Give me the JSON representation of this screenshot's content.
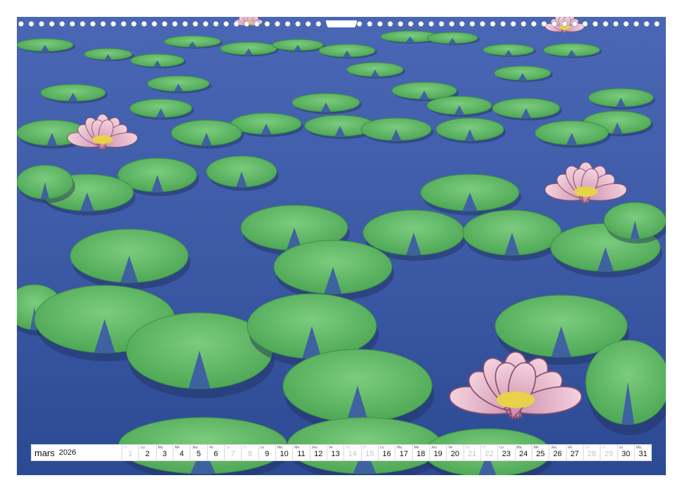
{
  "calendar": {
    "month": "mars",
    "year": "2026",
    "days": [
      {
        "wd": "Di",
        "num": "1",
        "weekend": true
      },
      {
        "wd": "Lu",
        "num": "2",
        "weekend": false
      },
      {
        "wd": "Ma",
        "num": "3",
        "weekend": false
      },
      {
        "wd": "Me",
        "num": "4",
        "weekend": false
      },
      {
        "wd": "Jeu",
        "num": "5",
        "weekend": false
      },
      {
        "wd": "Ve",
        "num": "6",
        "weekend": false
      },
      {
        "wd": "Sa",
        "num": "7",
        "weekend": true
      },
      {
        "wd": "Di",
        "num": "8",
        "weekend": true
      },
      {
        "wd": "Lu",
        "num": "9",
        "weekend": false
      },
      {
        "wd": "Ma",
        "num": "10",
        "weekend": false
      },
      {
        "wd": "Me",
        "num": "11",
        "weekend": false
      },
      {
        "wd": "Jeu",
        "num": "12",
        "weekend": false
      },
      {
        "wd": "Ve",
        "num": "13",
        "weekend": false
      },
      {
        "wd": "Sa",
        "num": "14",
        "weekend": true
      },
      {
        "wd": "Di",
        "num": "15",
        "weekend": true
      },
      {
        "wd": "Lu",
        "num": "16",
        "weekend": false
      },
      {
        "wd": "Ma",
        "num": "17",
        "weekend": false
      },
      {
        "wd": "Me",
        "num": "18",
        "weekend": false
      },
      {
        "wd": "Jeu",
        "num": "19",
        "weekend": false
      },
      {
        "wd": "Ve",
        "num": "20",
        "weekend": false
      },
      {
        "wd": "Sa",
        "num": "21",
        "weekend": true
      },
      {
        "wd": "Di",
        "num": "22",
        "weekend": true
      },
      {
        "wd": "Lu",
        "num": "23",
        "weekend": false
      },
      {
        "wd": "Ma",
        "num": "24",
        "weekend": false
      },
      {
        "wd": "Me",
        "num": "25",
        "weekend": false
      },
      {
        "wd": "Jeu",
        "num": "26",
        "weekend": false
      },
      {
        "wd": "Ve",
        "num": "27",
        "weekend": false
      },
      {
        "wd": "Sa",
        "num": "28",
        "weekend": true
      },
      {
        "wd": "Di",
        "num": "29",
        "weekend": true
      },
      {
        "wd": "Lu",
        "num": "30",
        "weekend": false
      },
      {
        "wd": "Ma",
        "num": "31",
        "weekend": false
      }
    ]
  },
  "colors": {
    "water": "#3b5aa8",
    "pad": "#5fb866",
    "petal": "#e9b6c9",
    "weekend_text": "#c4c4c4"
  }
}
